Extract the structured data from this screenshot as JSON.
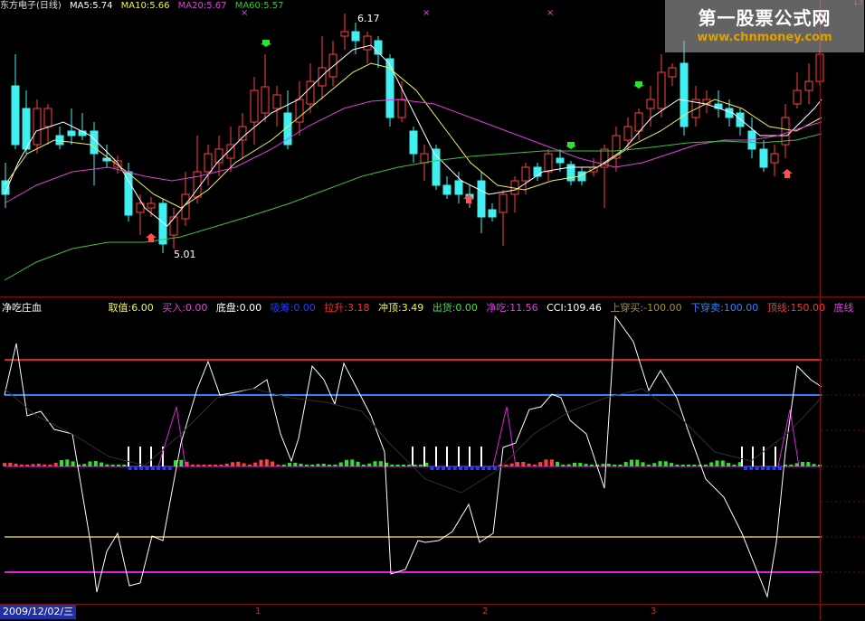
{
  "colors": {
    "up": "#ff4040",
    "down": "#40f0f0",
    "ma5": "#ffffff",
    "ma10": "#f0f060",
    "ma20": "#e040e0",
    "ma60": "#40c040",
    "red_line": "#e02020",
    "blue_line": "#3080ff",
    "olive_line": "#a09040",
    "magenta_line": "#e020e0"
  },
  "header": {
    "title": "东方电子(日线)",
    "ma5": "MA5:5.74",
    "ma10": "MA10:5.66",
    "ma20": "MA20:5.67",
    "ma60": "MA60:5.57"
  },
  "indicator_header": {
    "name": "净吃庄血",
    "item0": "取值:6.00",
    "item1": "买入:0.00",
    "item2": "底盘:0.00",
    "item3": "吸筹:0.00",
    "item4": "拉升:3.18",
    "item5": "冲顶:3.49",
    "item6": "出货:0.00",
    "item7": "净吃:11.56",
    "item8": "CCI:109.46",
    "item9": "上穿买:-100.00",
    "item10": "下穿卖:100.00",
    "item11": "顶线:150.00",
    "item12": "底线"
  },
  "footer": {
    "date": "2009/12/02/三",
    "m1": "1",
    "m2": "2",
    "m3": "3"
  },
  "annotations": {
    "high": "6.17",
    "low": "5.01",
    "corner": "13"
  },
  "watermark": {
    "title": "第一股票公式网",
    "url": "www.chnmoney.com"
  },
  "chart_data": [
    {
      "type": "candlestick",
      "title": "东方电子(日线)",
      "series_names": [
        "MA5",
        "MA10",
        "MA20",
        "MA60"
      ],
      "high_label": 6.17,
      "low_label": 5.01
    },
    {
      "type": "line",
      "title": "净吃庄血",
      "levels": [
        150,
        100,
        0,
        -100,
        -150
      ]
    }
  ]
}
